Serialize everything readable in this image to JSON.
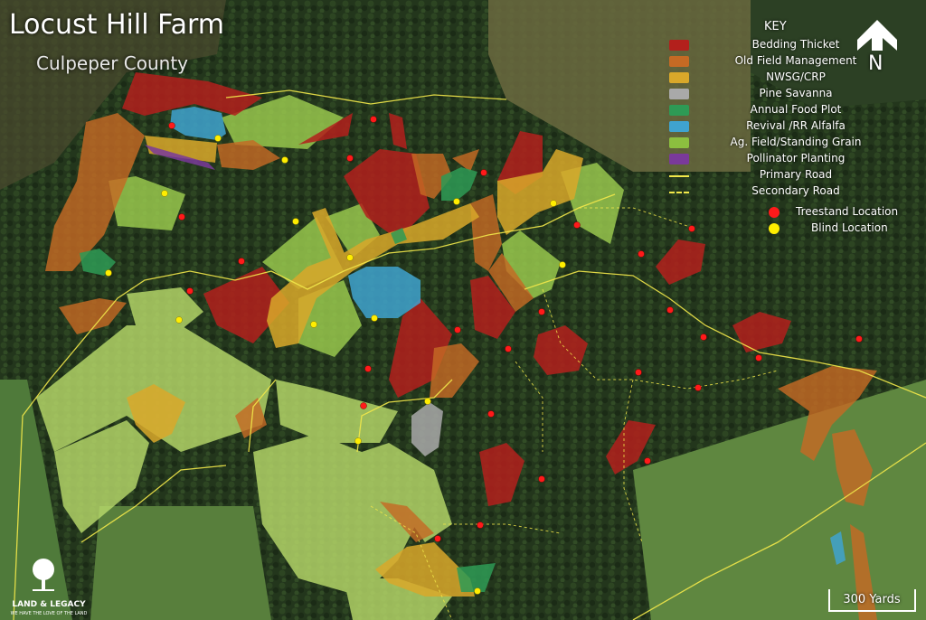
{
  "title": "Locust Hill Farm",
  "subtitle": "Culpeper County",
  "key": {
    "heading": "KEY",
    "items": [
      {
        "label": "Bedding Thicket",
        "color": "#b3201c",
        "kind": "swatch"
      },
      {
        "label": "Old Field Management",
        "color": "#c56a24",
        "kind": "swatch"
      },
      {
        "label": "NWSG/CRP",
        "color": "#d9a82a",
        "kind": "swatch"
      },
      {
        "label": "Pine Savanna",
        "color": "#a9a9a9",
        "kind": "swatch"
      },
      {
        "label": "Annual Food Plot",
        "color": "#2e9a55",
        "kind": "swatch"
      },
      {
        "label": "Revival /RR Alfalfa",
        "color": "#3fa3cf",
        "kind": "swatch"
      },
      {
        "label": "Ag. Field/Standing Grain",
        "color": "#8cbf3f",
        "kind": "swatch"
      },
      {
        "label": "Pollinator Planting",
        "color": "#7a3a9a",
        "kind": "swatch"
      },
      {
        "label": "Primary Road",
        "color": "#f2e84a",
        "kind": "line"
      },
      {
        "label": "Secondary Road",
        "color": "#f2e84a",
        "kind": "dash"
      },
      {
        "label": "Treestand Location",
        "color": "#ff1a1a",
        "kind": "dot"
      },
      {
        "label": "Blind Location",
        "color": "#ffee00",
        "kind": "dot"
      }
    ]
  },
  "north_label": "N",
  "scale_label": "300 Yards",
  "logo": {
    "name": "LAND & LEGACY",
    "tagline": "WE HAVE THE LOVE OF THE LAND"
  }
}
